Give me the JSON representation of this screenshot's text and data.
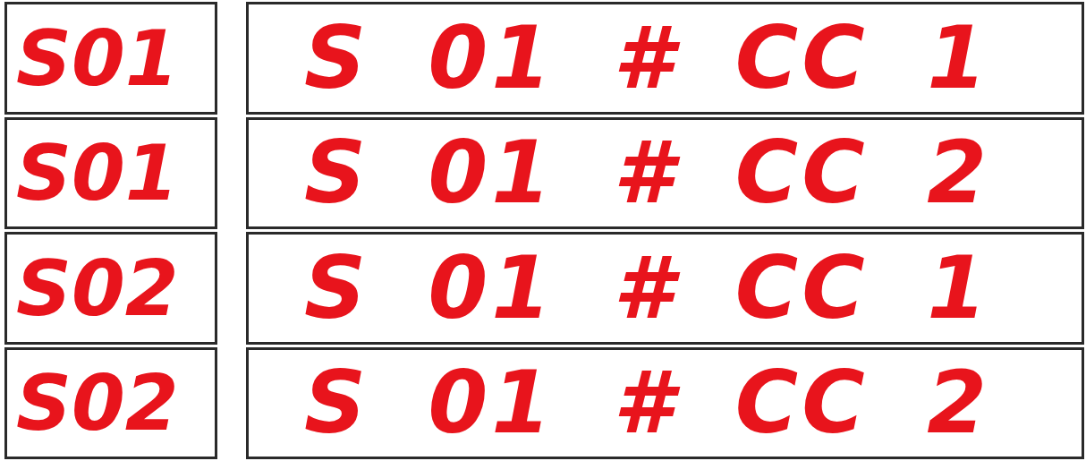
{
  "rows": [
    {
      "code": "S01",
      "display": "S 01 # CC 1"
    },
    {
      "code": "S01",
      "display": "S 01 # CC 2"
    },
    {
      "code": "S02",
      "display": "S 01 # CC 1"
    },
    {
      "code": "S02",
      "display": "S 01 # CC 2"
    }
  ]
}
